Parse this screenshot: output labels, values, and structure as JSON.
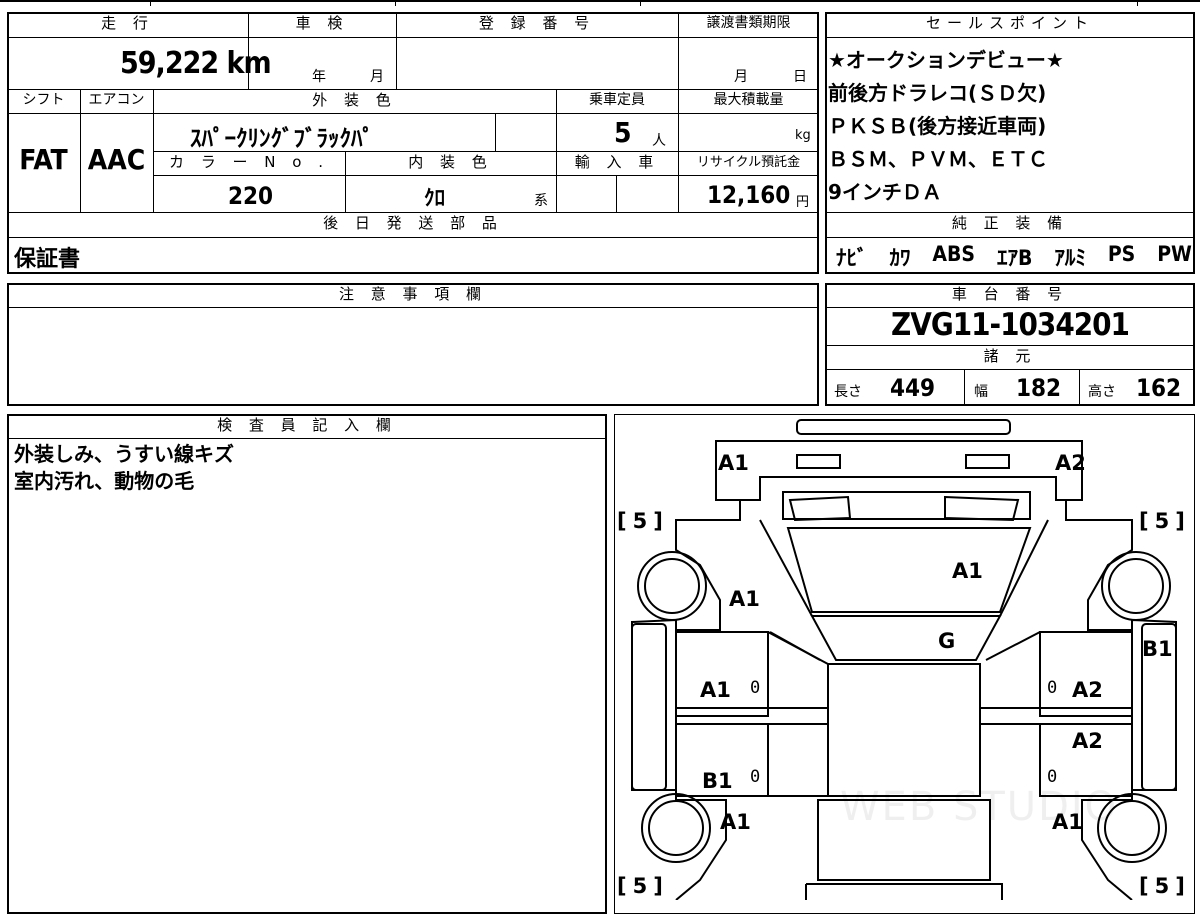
{
  "header": {
    "mileage_label": "走 行",
    "inspection_label": "車 検",
    "registration_label": "登 録 番 号",
    "transfer_deadline_label": "譲渡書類期限",
    "sales_points_label": "セールスポイント"
  },
  "vehicle": {
    "mileage": "59,222 km",
    "inspection_year_unit": "年",
    "inspection_month_unit": "月",
    "transfer_month_unit": "月",
    "transfer_day_unit": "日",
    "shift_label": "シフト",
    "ac_label": "エアコン",
    "exterior_color_label": "外 装 色",
    "capacity_label": "乗車定員",
    "max_load_label": "最大積載量",
    "shift": "FAT",
    "ac": "AAC",
    "exterior_color": "ｽﾊﾟｰｸﾘﾝｸﾞﾌﾞﾗｯｸﾊﾟ",
    "capacity": "5",
    "capacity_unit": "人",
    "load_unit": "kg",
    "color_no_label": "カ ラ ー N o .",
    "interior_color_label": "内 装 色",
    "import_label": "輸 入 車",
    "recycle_label": "リサイクル預託金",
    "color_no": "220",
    "interior_color": "ｸﾛ",
    "interior_suffix": "系",
    "recycle_fee": "12,160",
    "recycle_unit": "円"
  },
  "sales_points": [
    "★オークションデビュー★",
    "前後方ドラレコ(ＳＤ欠)",
    "ＰＫＳＢ(後方接近車両)",
    "ＢＳＭ、ＰＶＭ、ＥＴＣ",
    "9インチＤＡ"
  ],
  "later_parts": {
    "label": "後 日 発 送 部 品",
    "value": "保証書"
  },
  "equipment": {
    "label": "純 正 装 備",
    "items": [
      "ﾅﾋﾞ",
      "ｶﾜ",
      "ABS",
      "ｴｱB",
      "ｱﾙﾐ",
      "PS",
      "PW"
    ]
  },
  "notes": {
    "label": "注 意 事 項 欄",
    "value": ""
  },
  "chassis": {
    "label": "車 台 番 号",
    "number": "ZVG11-1034201",
    "spec_label": "諸 元",
    "length_label": "長さ",
    "length": "449",
    "width_label": "幅",
    "width": "182",
    "height_label": "高さ",
    "height": "162"
  },
  "inspector": {
    "label": "検 査 員 記 入 欄",
    "lines": [
      "外装しみ、うすい線キズ",
      "室内汚れ、動物の毛"
    ]
  },
  "diagram": {
    "tire_top_left": "5",
    "tire_top_right": "5",
    "tire_bottom_left": "5",
    "tire_bottom_right": "5",
    "mark_rear_left": "A1",
    "mark_rear_right": "A2",
    "mark_roof": "A1",
    "mark_left_quarter": "A1",
    "mark_windshield": "G",
    "mark_right_quarter": "B1",
    "mark_left_rear_door": "A1",
    "mark_right_rear_door": "A2",
    "mark_right_front_door": "A2",
    "mark_left_front_door": "B1",
    "mark_left_front_fender": "A1",
    "mark_right_front_fender": "A1",
    "zero": "0",
    "watermark": "WEB STUDIO"
  }
}
